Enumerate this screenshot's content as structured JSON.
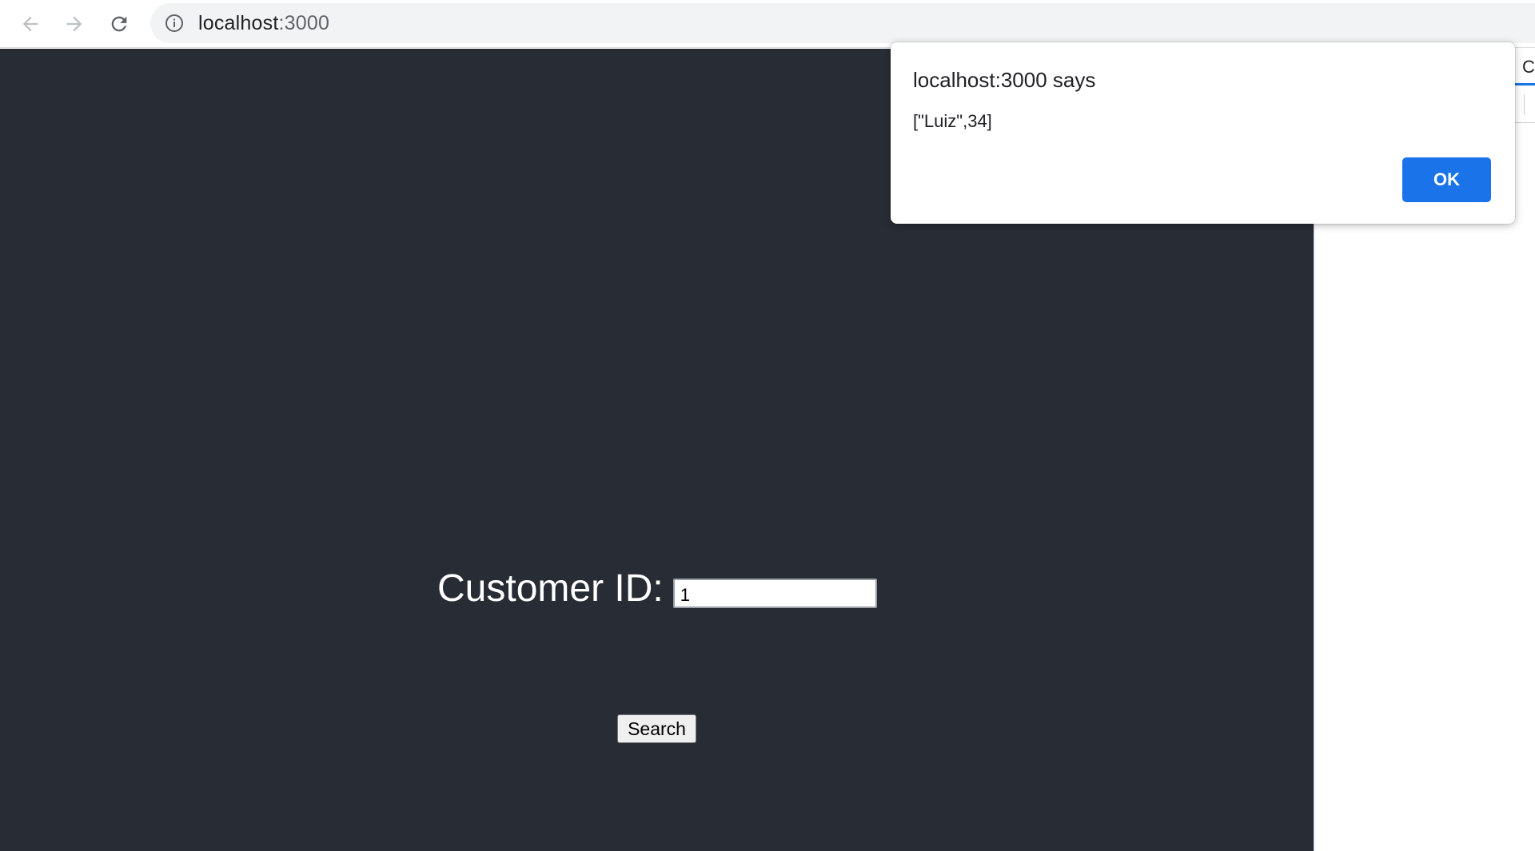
{
  "browser": {
    "url_host": "localhost",
    "url_port": ":3000",
    "icons": {
      "back": "arrow-left-icon",
      "forward": "arrow-right-icon",
      "reload": "reload-icon",
      "site_info": "info-icon"
    }
  },
  "form": {
    "label": "Customer ID:",
    "input_value": "1",
    "search_label": "Search"
  },
  "devtools": {
    "tab_label": "C"
  },
  "dialog": {
    "title": "localhost:3000 says",
    "message": "[\"Luiz\",34]",
    "ok_label": "OK"
  },
  "colors": {
    "page_background": "#282c34",
    "dialog_button": "#1a73e8",
    "devtools_accent": "#1a73e8"
  }
}
